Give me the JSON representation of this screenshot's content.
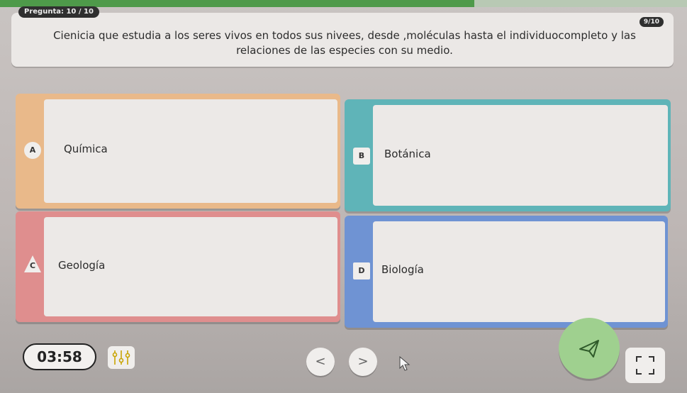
{
  "header": {
    "question_label": "Pregunta: 10 / 10",
    "count_badge": "9/10"
  },
  "question": {
    "text": "Cienicia que estudia a los seres vivos en todos sus nivees, desde ,moléculas hasta el individuocompleto y las relaciones de las especies con su medio."
  },
  "options": [
    {
      "letter": "A",
      "text": "Química",
      "color": "#e9b98a"
    },
    {
      "letter": "B",
      "text": "Botánica",
      "color": "#5fb4b8"
    },
    {
      "letter": "C",
      "text": "Geología",
      "color": "#df8e8e"
    },
    {
      "letter": "D",
      "text": "Biología",
      "color": "#6f93d3"
    }
  ],
  "footer": {
    "timer": "03:58",
    "prev_label": "<",
    "next_label": ">"
  },
  "icons": {
    "tools": "sliders-icon",
    "submit": "paper-plane-icon",
    "fullscreen": "fullscreen-icon",
    "cursor": "mouse-cursor-icon"
  },
  "colors": {
    "progress": "#4e9a4a",
    "submit": "#9fd08f"
  }
}
